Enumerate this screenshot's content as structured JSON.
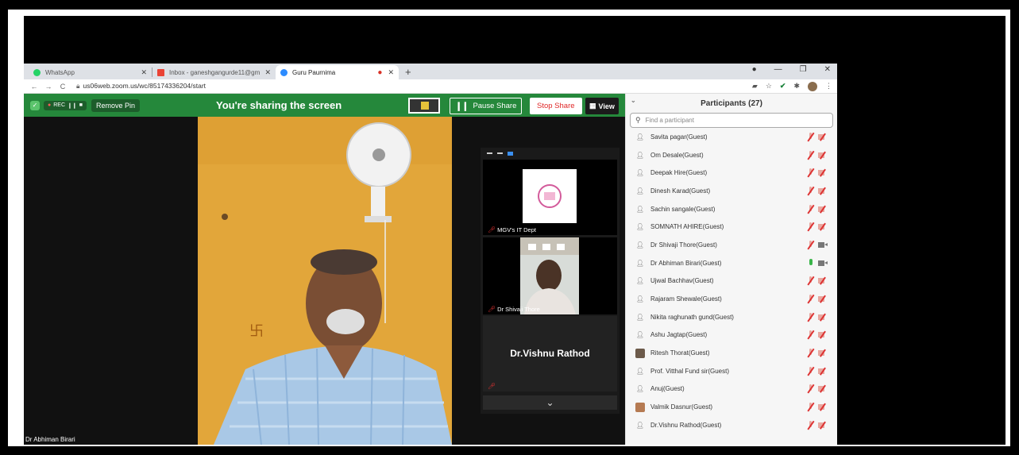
{
  "browser": {
    "tabs": [
      {
        "label": "WhatsApp",
        "icon": "whatsapp-icon",
        "color": "#25d366"
      },
      {
        "label": "Inbox - ganeshgangurde11@gm",
        "icon": "gmail-icon",
        "color": "#ea4335"
      },
      {
        "label": "Guru Paurnima",
        "icon": "zoom-icon",
        "color": "#2d8cff",
        "active": true
      }
    ],
    "url": "us06web.zoom.us/wc/85174336204/start"
  },
  "zoom": {
    "rec_label": "REC",
    "remove_pin_label": "Remove Pin",
    "share_title": "You're sharing the screen",
    "pause_label": "Pause Share",
    "stop_label": "Stop Share",
    "view_label": "View",
    "accent_green": "#25883b",
    "speaker_name": "Dr Abhiman Birari",
    "gallery": [
      {
        "name": "MGV's IT Dept"
      },
      {
        "name": "Dr Shivaji Thore"
      },
      {
        "name": "Dr.Vishnu Rathod"
      }
    ]
  },
  "participants": {
    "title": "Participants (27)",
    "search_placeholder": "Find a participant",
    "list": [
      {
        "name": "Savita pagar(Guest)",
        "avatar": "default",
        "mic": "off",
        "cam": "off"
      },
      {
        "name": "Om Desale(Guest)",
        "avatar": "default",
        "mic": "off",
        "cam": "off"
      },
      {
        "name": "Deepak Hire(Guest)",
        "avatar": "default",
        "mic": "off",
        "cam": "off"
      },
      {
        "name": "Dinesh Karad(Guest)",
        "avatar": "default",
        "mic": "off",
        "cam": "off"
      },
      {
        "name": "Sachin sangale(Guest)",
        "avatar": "default",
        "mic": "off",
        "cam": "off"
      },
      {
        "name": "SOMNATH AHIRE(Guest)",
        "avatar": "default",
        "mic": "off",
        "cam": "off"
      },
      {
        "name": "Dr Shivaji Thore(Guest)",
        "avatar": "default",
        "mic": "off",
        "cam": "on"
      },
      {
        "name": "Dr Abhiman Birari(Guest)",
        "avatar": "default",
        "mic": "on",
        "cam": "on"
      },
      {
        "name": "Ujwal Bachhav(Guest)",
        "avatar": "default",
        "mic": "off",
        "cam": "off"
      },
      {
        "name": "Rajaram Shewale(Guest)",
        "avatar": "default",
        "mic": "off",
        "cam": "off"
      },
      {
        "name": "Nikita raghunath gund(Guest)",
        "avatar": "default",
        "mic": "off",
        "cam": "off"
      },
      {
        "name": "Ashu Jagtap(Guest)",
        "avatar": "default",
        "mic": "off",
        "cam": "off"
      },
      {
        "name": "Ritesh Thorat(Guest)",
        "avatar": "photo2",
        "mic": "off",
        "cam": "off"
      },
      {
        "name": "Prof. Vitthal Fund sir(Guest)",
        "avatar": "default",
        "mic": "off",
        "cam": "off"
      },
      {
        "name": "Anuj(Guest)",
        "avatar": "default",
        "mic": "off",
        "cam": "off"
      },
      {
        "name": "Valmik Dasnur(Guest)",
        "avatar": "photo",
        "mic": "off",
        "cam": "off"
      },
      {
        "name": "Dr.Vishnu Rathod(Guest)",
        "avatar": "default",
        "mic": "off",
        "cam": "off"
      }
    ]
  }
}
